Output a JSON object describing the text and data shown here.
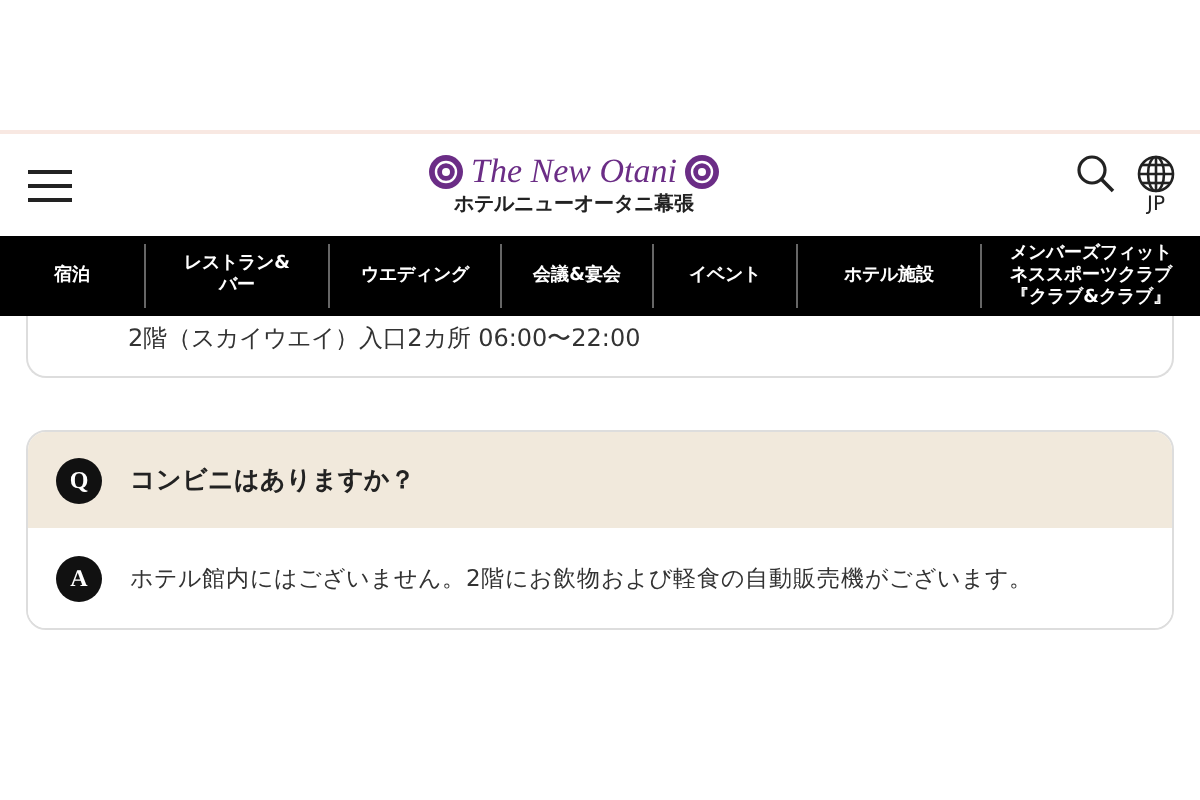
{
  "header": {
    "logo": "The New Otani",
    "hotel_name": "ホテルニューオータニ幕張",
    "language": "JP"
  },
  "nav": [
    "宿泊",
    "レストラン&バー",
    "ウエディング",
    "会議&宴会",
    "イベント",
    "ホテル施設",
    "メンバーズフィットネススポーツクラブ『クラブ&クラブ』"
  ],
  "partial_answer": "2階（スカイウエイ）入口2カ所 06:00〜22:00",
  "faq": [
    {
      "q_mark": "Q",
      "question": "コンビニはありますか？",
      "a_mark": "A",
      "answer": "ホテル館内にはございません。2階にお飲物および軽食の自動販売機がございます。"
    }
  ]
}
